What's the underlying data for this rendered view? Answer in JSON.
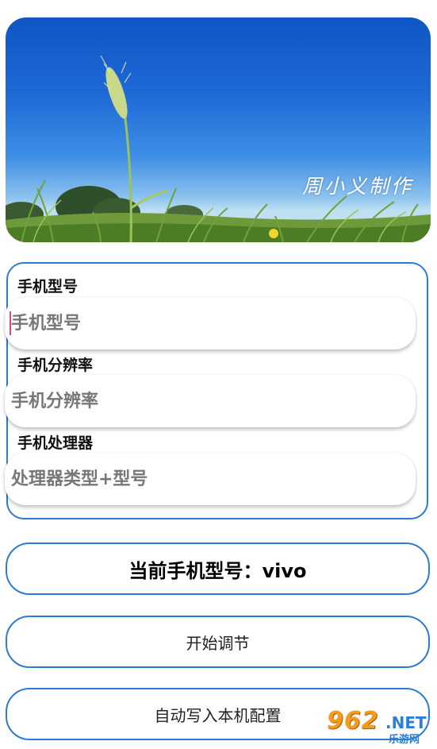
{
  "banner": {
    "caption": "周小义制作"
  },
  "form": {
    "model": {
      "label": "手机型号",
      "placeholder": "手机型号"
    },
    "resolution": {
      "label": "手机分辨率",
      "placeholder": "手机分辨率"
    },
    "processor": {
      "label": "手机处理器",
      "placeholder": "处理器类型+型号"
    }
  },
  "current_model": "当前手机型号：vivo",
  "buttons": {
    "start": "开始调节",
    "write": "自动写入本机配置"
  },
  "watermark": {
    "number": "962",
    "suffix": ".NET",
    "sub": "乐游网"
  },
  "colors": {
    "accent_border": "#2b7bd6",
    "caret": "#e0457b",
    "watermark_orange": "#f29b1f",
    "watermark_blue": "#2a7fd8"
  }
}
